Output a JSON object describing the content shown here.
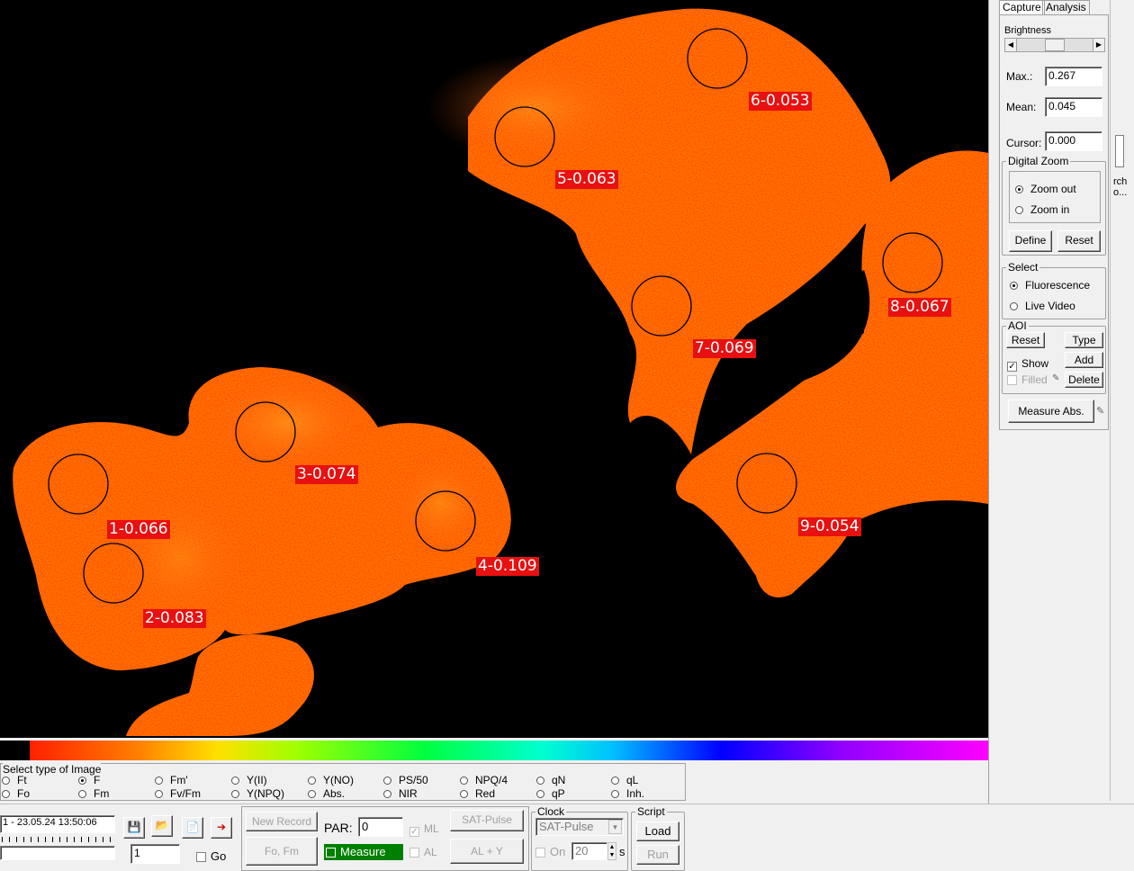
{
  "aoi_labels": [
    {
      "text": "1-0.066"
    },
    {
      "text": "2-0.083"
    },
    {
      "text": "3-0.074"
    },
    {
      "text": "4-0.109"
    },
    {
      "text": "5-0.063"
    },
    {
      "text": "6-0.053"
    },
    {
      "text": "7-0.069"
    },
    {
      "text": "8-0.067"
    },
    {
      "text": "9-0.054"
    }
  ],
  "colors": {
    "aoi_label_bg": "#e81010",
    "leaf_base": "#ff4a10",
    "measure_active": "#008000"
  },
  "side_panel": {
    "tabs": [
      "Capture",
      "Analysis"
    ],
    "brightness_label": "Brightness",
    "max_label": "Max.:",
    "max_value": "0.267",
    "mean_label": "Mean:",
    "mean_value": "0.045",
    "cursor_label": "Cursor:",
    "cursor_value": "0.000",
    "digital_zoom_title": "Digital Zoom",
    "zoom_out": "Zoom out",
    "zoom_in": "Zoom in",
    "define": "Define",
    "reset": "Reset",
    "select_title": "Select",
    "fluorescence": "Fluorescence",
    "live_video": "Live Video",
    "aoi_title": "AOI",
    "aoi_reset": "Reset",
    "aoi_type": "Type",
    "show": "Show",
    "add": "Add",
    "filled": "Filled",
    "delete": "Delete",
    "measure_abs": "Measure Abs.",
    "overflow_text": "rch\no..."
  },
  "image_type": {
    "title": "Select type of Image",
    "row1": [
      "Ft",
      "F",
      "Fm'",
      "Y(II)",
      "Y(NO)",
      "PS/50",
      "NPQ/4",
      "qN",
      "qL"
    ],
    "row2": [
      "Fo",
      "Fm",
      "Fv/Fm",
      "Y(NPQ)",
      "Abs.",
      "NIR",
      "Red",
      "qP",
      "Inh."
    ],
    "selected": "F"
  },
  "bottom": {
    "record_value": "1 - 23.05.24 13:50:06",
    "record_number": "1",
    "go_label": "Go",
    "new_record": "New Record",
    "fo_fm": "Fo, Fm",
    "par_label": "PAR:",
    "par_value": "0",
    "measure": "Measure",
    "ml": "ML",
    "al": "AL",
    "sat_pulse_btn": "SAT-Pulse",
    "al_y": "AL + Y",
    "clock_title": "Clock",
    "clock_select": "SAT-Pulse",
    "on_label": "On",
    "interval_value": "20",
    "interval_unit": "s",
    "script_title": "Script",
    "load": "Load",
    "run": "Run"
  }
}
